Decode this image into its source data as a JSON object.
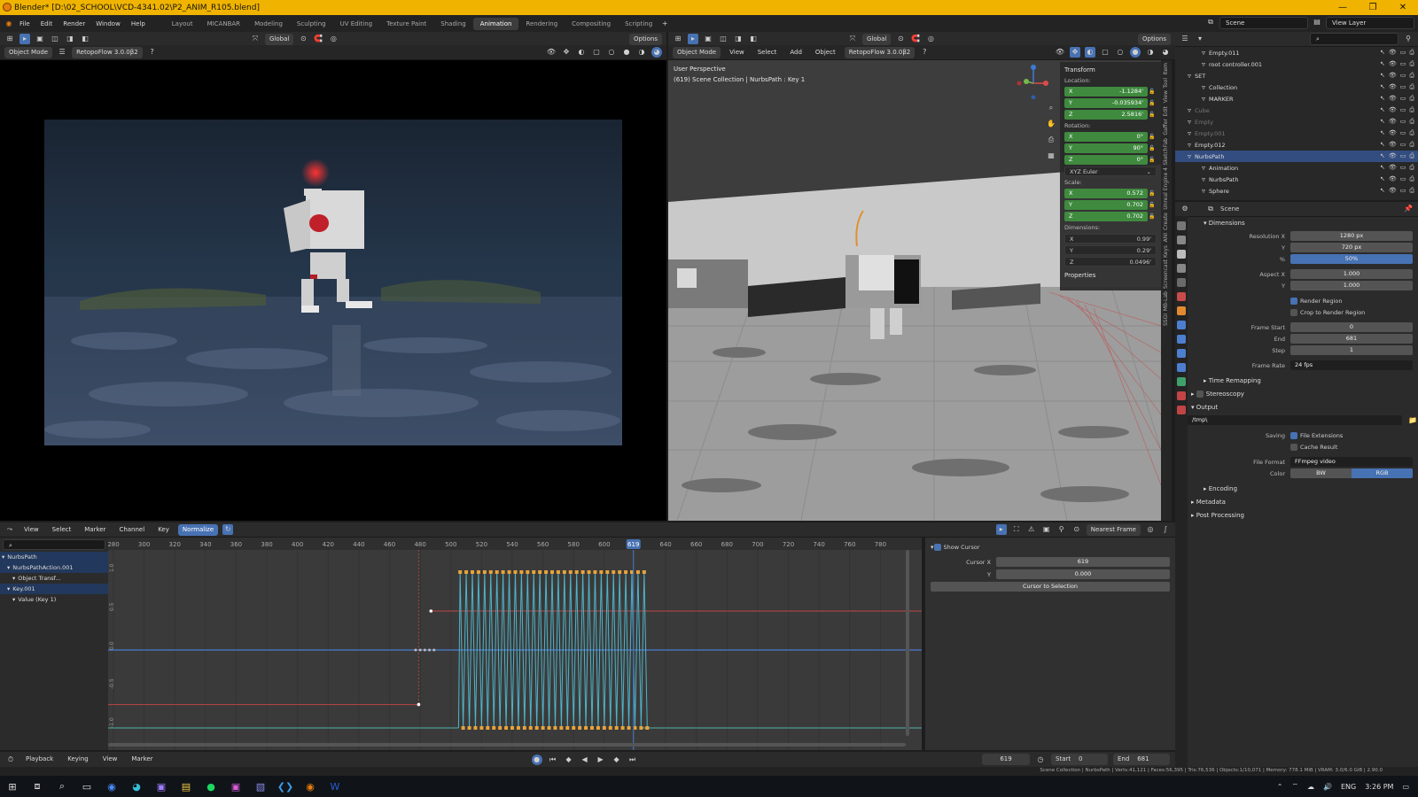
{
  "window": {
    "title": "Blender* [D:\\02_SCHOOL\\VCD-4341.02\\P2_ANIM_R105.blend]",
    "controls": [
      "—",
      "❐",
      "✕"
    ]
  },
  "menubar": {
    "menus": [
      "File",
      "Edit",
      "Render",
      "Window",
      "Help"
    ],
    "workspaces": [
      "Layout",
      "MICANBAR",
      "Modeling",
      "Sculpting",
      "UV Editing",
      "Texture Paint",
      "Shading",
      "Animation",
      "Rendering",
      "Compositing",
      "Scripting"
    ],
    "active_workspace": "Animation",
    "scene": "Scene",
    "view_layer": "View Layer"
  },
  "left_view": {
    "transform": "Global",
    "options": "Options",
    "mode": "Object Mode",
    "addon": "RetopoFlow 3.0.0β2"
  },
  "viewport3d": {
    "menus": [
      "View",
      "Select",
      "Add",
      "Object"
    ],
    "mode": "Object Mode",
    "transform": "Global",
    "options": "Options",
    "addon": "RetopoFlow 3.0.0β2",
    "overlay_title": "User Perspective",
    "overlay_sub": "(619) Scene Collection | NurbsPath : Key 1"
  },
  "npanel": {
    "title": "Transform",
    "location_label": "Location:",
    "location": [
      [
        "X",
        "-1.1284'"
      ],
      [
        "Y",
        "-0.035934'"
      ],
      [
        "Z",
        "2.5816'"
      ]
    ],
    "rotation_label": "Rotation:",
    "rotation": [
      [
        "X",
        "0°"
      ],
      [
        "Y",
        "90°"
      ],
      [
        "Z",
        "0°"
      ]
    ],
    "rotation_mode": "XYZ Euler",
    "scale_label": "Scale:",
    "scale": [
      [
        "X",
        "0.572"
      ],
      [
        "Y",
        "0.702"
      ],
      [
        "Z",
        "0.702"
      ]
    ],
    "dimensions_label": "Dimensions:",
    "dimensions": [
      [
        "X",
        "0.99'"
      ],
      [
        "Y",
        "0.29'"
      ],
      [
        "Z",
        "0.0496'"
      ]
    ],
    "properties": "Properties",
    "tabs": [
      "Item",
      "Tool",
      "View",
      "Edit",
      "Gaffer",
      "SketchFab",
      "Unreal Engine 4",
      "Create",
      "ANI",
      "Screencast Keys",
      "MB-Lab",
      "SSGI"
    ]
  },
  "outliner": {
    "search_placeholder": "",
    "rows": [
      {
        "name": "Empty.011",
        "state": "normal"
      },
      {
        "name": "root controller.001",
        "state": "normal"
      },
      {
        "name": "SET",
        "state": "normal"
      },
      {
        "name": "Collection",
        "state": "normal"
      },
      {
        "name": "MARKER",
        "state": "normal"
      },
      {
        "name": "Cube",
        "state": "dim"
      },
      {
        "name": "Empty",
        "state": "dim"
      },
      {
        "name": "Empty.001",
        "state": "dim"
      },
      {
        "name": "Empty.012",
        "state": "normal"
      },
      {
        "name": "NurbsPath",
        "state": "selected"
      },
      {
        "name": "Animation",
        "state": "normal"
      },
      {
        "name": "NurbsPath",
        "state": "normal"
      },
      {
        "name": "Sphere",
        "state": "normal"
      }
    ]
  },
  "properties": {
    "scene": "Scene",
    "dimensions": "Dimensions",
    "resolution_x_label": "Resolution X",
    "resolution_x": "1280 px",
    "resolution_y_label": "Y",
    "resolution_y": "720 px",
    "percent_label": "%",
    "percent": "50%",
    "aspect_x_label": "Aspect X",
    "aspect_x": "1.000",
    "aspect_y_label": "Y",
    "aspect_y": "1.000",
    "render_region": "Render Region",
    "crop_region": "Crop to Render Region",
    "frame_start_label": "Frame Start",
    "frame_start": "0",
    "end_label": "End",
    "end": "681",
    "step_label": "Step",
    "step": "1",
    "frame_rate_label": "Frame Rate",
    "frame_rate": "24 fps",
    "time_remapping": "Time Remapping",
    "stereoscopy": "Stereoscopy",
    "output": "Output",
    "output_path": "/tmp\\",
    "saving_label": "Saving",
    "file_extensions": "File Extensions",
    "cache_result": "Cache Result",
    "file_format_label": "File Format",
    "file_format": "FFmpeg video",
    "color_label": "Color",
    "color_bw": "BW",
    "color_rgb": "RGB",
    "encoding": "Encoding",
    "metadata": "Metadata",
    "post_processing": "Post Processing"
  },
  "graph_editor": {
    "menus": [
      "View",
      "Select",
      "Marker",
      "Channel",
      "Key"
    ],
    "normalize": "Normalize",
    "snap": "Nearest Frame",
    "ruler": [
      "280",
      "300",
      "320",
      "340",
      "360",
      "380",
      "400",
      "420",
      "440",
      "460",
      "480",
      "500",
      "520",
      "540",
      "560",
      "580",
      "600",
      "619",
      "640",
      "660",
      "680",
      "700",
      "720",
      "740",
      "760",
      "780"
    ],
    "y_labels": [
      "1.0",
      "0.5",
      "0.0",
      "-0.5",
      "-1.0"
    ],
    "channels": [
      {
        "label": "NurbsPath",
        "style": "blue"
      },
      {
        "label": "NurbsPathAction.001",
        "style": "blue"
      },
      {
        "label": "Object Transf...",
        "style": "normal"
      },
      {
        "label": "Key.001",
        "style": "blue"
      },
      {
        "label": "Value (Key 1)",
        "style": "normal"
      }
    ],
    "show_cursor": "Show Cursor",
    "cursor_x_label": "Cursor X",
    "cursor_x": "619",
    "cursor_y_label": "Y",
    "cursor_y": "0.000",
    "cursor_to_selection": "Cursor to Selection"
  },
  "timeline": {
    "menus": [
      "Playback",
      "Keying",
      "View",
      "Marker"
    ],
    "current_frame": "619",
    "start_label": "Start",
    "start": "0",
    "end_label": "End",
    "end": "681"
  },
  "statusbar": "Scene Collection | NurbsPath | Verts:41,121 | Faces:56,395 | Tris:76,536 | Objects:1/10,071 | Memory: 778.1 MiB | VRAM: 3.0/6.0 GiB | 2.90.0",
  "taskbar": {
    "lang": "ENG",
    "time": "3:26 PM"
  },
  "colors": {
    "accent": "#4772b3",
    "titlebar": "#f0b400",
    "keyframe": "#e8a33a",
    "curve": "#4fb3c8"
  }
}
